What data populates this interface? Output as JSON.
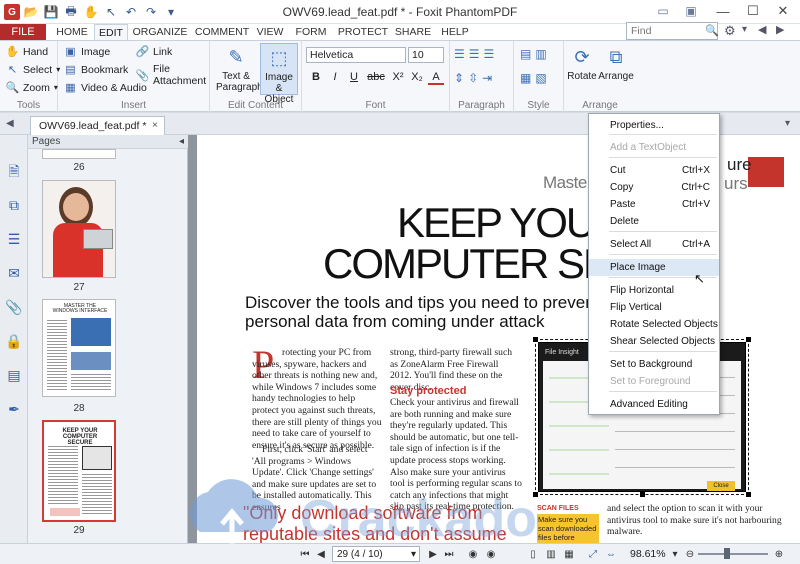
{
  "window": {
    "title": "OWV69.lead_feat.pdf * - Foxit PhantomPDF",
    "app_icon": "G",
    "controls": [
      "—",
      "☐",
      "✕"
    ]
  },
  "ribbon_tabs": [
    "FILE",
    "HOME",
    "EDIT",
    "ORGANIZE",
    "COMMENT",
    "VIEW",
    "FORM",
    "PROTECT",
    "SHARE",
    "HELP"
  ],
  "search": {
    "placeholder": "Find"
  },
  "ribbon": {
    "tools": {
      "label": "Tools",
      "hand": "Hand",
      "select": "Select",
      "zoom": "Zoom"
    },
    "insert": {
      "label": "Insert",
      "image": "Image",
      "bookmark": "Bookmark",
      "video": "Video & Audio",
      "link": "Link",
      "attachment": "File Attachment"
    },
    "edit_content": {
      "label": "Edit Content",
      "text_paragraph": "Text &\nParagraph",
      "image_object": "Image &\nObject"
    },
    "font": {
      "label": "Font",
      "family": "Helvetica",
      "size": "10",
      "buttons": [
        "B",
        "I",
        "U",
        "abc",
        "X²",
        "X₂",
        "A"
      ]
    },
    "paragraph": {
      "label": "Paragraph"
    },
    "style": {
      "label": "Style"
    },
    "arrange": {
      "label": "Arrange",
      "rotate": "Rotate",
      "arrange": "Arrange"
    }
  },
  "doc_tab": {
    "name": "OWV69.lead_feat.pdf *",
    "close": "×"
  },
  "pages_panel": {
    "header": "Pages",
    "thumbs": [
      {
        "num": "26"
      },
      {
        "num": "27"
      },
      {
        "num": "28",
        "heading": "MASTER THE WINDOWS INTERFACE"
      },
      {
        "num": "29",
        "heading": "KEEP YOUR COMPUTER SECURE"
      }
    ]
  },
  "article": {
    "kicker1": "Maste",
    "kicker2": "ure",
    "kicker3": "urs",
    "title_line1": "KEEP YOUR",
    "title_line2": "COMPUTER SEC",
    "subtitle_line1": "Discover the tools and tips you need to prevent y",
    "subtitle_line2": "personal data from coming under attack",
    "col1_dropcap": "P",
    "col1": "rotecting your PC from viruses, spyware, hackers and other threats is nothing new and, while Windows 7 includes some handy technologies to help protect you against such threats, there are still plenty of things you need to take care of yourself to ensure it's as secure as possible.",
    "col1b": "First, click 'Start' and select 'All programs > Windows Update'. Click 'Change settings' and make sure updates are set to be installed automatically. This ensures",
    "col2a": "strong, third-party firewall such as ZoneAlarm Free Firewall 2012. You'll find these on the cover disc.",
    "col2_heading": "Stay protected",
    "col2b": "Check your antivirus and firewall are both running and make sure they're regularly updated. This should be automatic, but one tell-tale sign of infection is if the update process stops working. Also make sure your antivirus tool is performing regular scans to catch any infections that might slip past its real-time protection.",
    "pullquote1": "\"Only download software from",
    "pullquote2": "reputable sites and don't assume",
    "scan_heading": "SCAN FILES",
    "scan_text": "Make sure you scan downloaded files before",
    "right_text": "and select the option to scan it with your antivirus tool to make sure it's not harbouring malware.",
    "screenshot_title": "File Insight",
    "screenshot_btn": "Close"
  },
  "context_menu": {
    "items": [
      {
        "label": "Properties...",
        "shortcut": "",
        "disabled": false
      },
      {
        "label": "Add a TextObject",
        "shortcut": "",
        "disabled": true
      },
      {
        "label": "Cut",
        "shortcut": "Ctrl+X",
        "disabled": false
      },
      {
        "label": "Copy",
        "shortcut": "Ctrl+C",
        "disabled": false
      },
      {
        "label": "Paste",
        "shortcut": "Ctrl+V",
        "disabled": false
      },
      {
        "label": "Delete",
        "shortcut": "",
        "disabled": false
      },
      {
        "label": "Select All",
        "shortcut": "Ctrl+A",
        "disabled": false
      },
      {
        "label": "Place Image",
        "shortcut": "",
        "disabled": false,
        "highlighted": true
      },
      {
        "label": "Flip Horizontal",
        "shortcut": "",
        "disabled": false
      },
      {
        "label": "Flip Vertical",
        "shortcut": "",
        "disabled": false
      },
      {
        "label": "Rotate Selected Objects",
        "shortcut": "",
        "disabled": false
      },
      {
        "label": "Shear Selected Objects",
        "shortcut": "",
        "disabled": false
      },
      {
        "label": "Set to Background",
        "shortcut": "",
        "disabled": false
      },
      {
        "label": "Set to Foreground",
        "shortcut": "",
        "disabled": true
      },
      {
        "label": "Advanced Editing",
        "shortcut": "",
        "disabled": false
      }
    ]
  },
  "status_bar": {
    "page_field": "29 (4 / 10)",
    "zoom": "98.61%"
  },
  "watermark": "Crackado",
  "colors": {
    "accent_red": "#c5342c",
    "file_tab": "#b32b2b",
    "ribbon_bg": "#f5f7fa",
    "menu_highlight": "#dde8f6"
  }
}
